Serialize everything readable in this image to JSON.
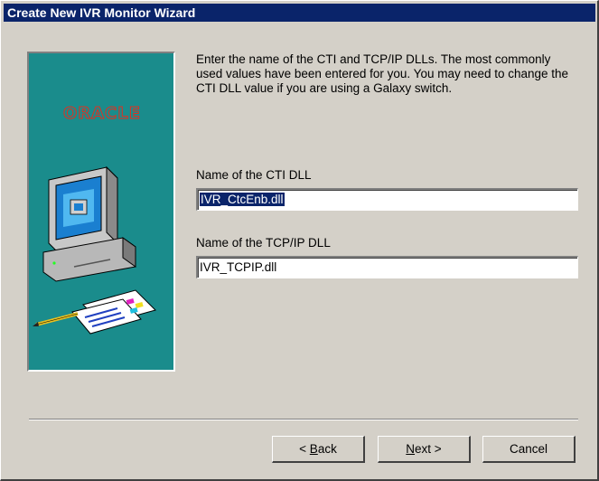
{
  "window": {
    "title": "Create New IVR Monitor Wizard"
  },
  "side_panel": {
    "logo_text": "ORACLE",
    "background_color": "#1a8c8c",
    "logo_color": "#e03020",
    "illustration_icons": [
      "computer-monitor-icon",
      "documents-pencil-icon"
    ]
  },
  "instructions": "Enter the name of the CTI and TCP/IP DLLs.  The most commonly used values have been entered for you.  You may need to change the CTI DLL value if you are using a Galaxy switch.",
  "fields": {
    "cti_dll": {
      "label": "Name of the CTI DLL",
      "value": "IVR_CtcEnb.dll",
      "selected": true
    },
    "tcpip_dll": {
      "label": "Name of the TCP/IP DLL",
      "value": "IVR_TCPIP.dll"
    }
  },
  "buttons": {
    "back": {
      "mnemonic": "B",
      "rest": "ack",
      "prefix": "< "
    },
    "next": {
      "mnemonic": "N",
      "rest": "ext >"
    },
    "cancel": {
      "label": "Cancel"
    }
  },
  "colors": {
    "titlebar": "#0a246a",
    "dialog_face": "#d4d0c8",
    "selection": "#0a246a"
  }
}
